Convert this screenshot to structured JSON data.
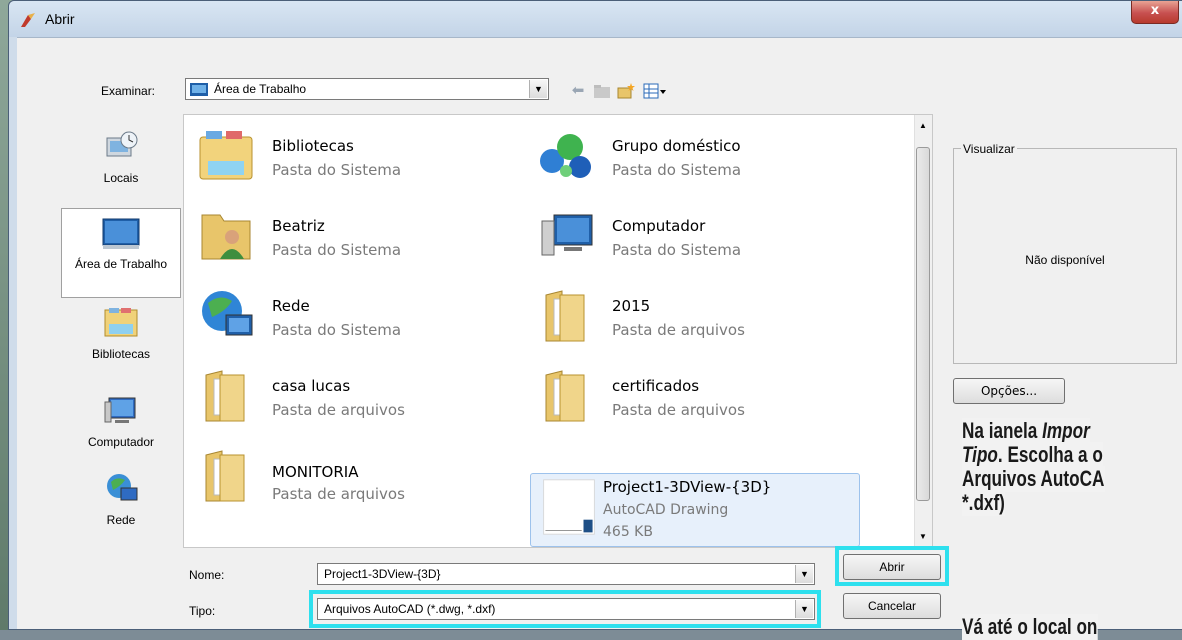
{
  "window": {
    "title": "Abrir",
    "close_label": "x"
  },
  "toolbar": {
    "look_in_label": "Examinar:",
    "look_in_value": "Área de Trabalho",
    "back_icon": "back-arrow-icon",
    "up_folder_icon": "up-folder-icon",
    "new_folder_icon": "new-folder-icon",
    "view_menu_icon": "view-menu-icon"
  },
  "places": [
    {
      "label": "Locais",
      "icon": "recent-places-icon"
    },
    {
      "label": "Área de Trabalho",
      "icon": "desktop-icon",
      "selected": true
    },
    {
      "label": "Bibliotecas",
      "icon": "libraries-icon"
    },
    {
      "label": "Computador",
      "icon": "computer-icon"
    },
    {
      "label": "Rede",
      "icon": "network-icon"
    }
  ],
  "files": [
    {
      "name": "Bibliotecas",
      "type": "Pasta do Sistema",
      "icon": "libraries-folder-icon"
    },
    {
      "name": "Grupo doméstico",
      "type": "Pasta do Sistema",
      "icon": "homegroup-icon"
    },
    {
      "name": "Beatriz",
      "type": "Pasta do Sistema",
      "icon": "user-folder-icon"
    },
    {
      "name": "Computador",
      "type": "Pasta do Sistema",
      "icon": "computer-icon"
    },
    {
      "name": "Rede",
      "type": "Pasta do Sistema",
      "icon": "network-globe-icon"
    },
    {
      "name": "2015",
      "type": "Pasta de arquivos",
      "icon": "folder-icon"
    },
    {
      "name": "casa lucas",
      "type": "Pasta de arquivos",
      "icon": "folder-icon"
    },
    {
      "name": "certificados",
      "type": "Pasta de arquivos",
      "icon": "folder-icon"
    },
    {
      "name": "MONITORIA",
      "type": "Pasta de arquivos",
      "icon": "folder-icon"
    },
    {
      "name": "Project1-3DView-{3D}",
      "type": "AutoCAD Drawing",
      "size": "465 KB",
      "icon": "dwg-file-icon",
      "selected": true
    }
  ],
  "filename": {
    "label": "Nome:",
    "value": "Project1-3DView-{3D}"
  },
  "filetype": {
    "label": "Tipo:",
    "value": "Arquivos AutoCAD (*.dwg, *.dxf)"
  },
  "buttons": {
    "open": "Abrir",
    "cancel": "Cancelar",
    "options": "Opções..."
  },
  "preview": {
    "legend": "Visualizar",
    "text": "Não disponível"
  },
  "overlay": {
    "l1a": "Na ianela ",
    "l1b": "Impor",
    "l2a": "Tipo",
    "l2b": ". Escolha a o",
    "l3": "Arquivos AutoCA",
    "l4": "*.dxf)",
    "l5": "Vá até o local on"
  },
  "colors": {
    "highlight": "#2ee0ee",
    "selection": "#e7f0fb"
  }
}
